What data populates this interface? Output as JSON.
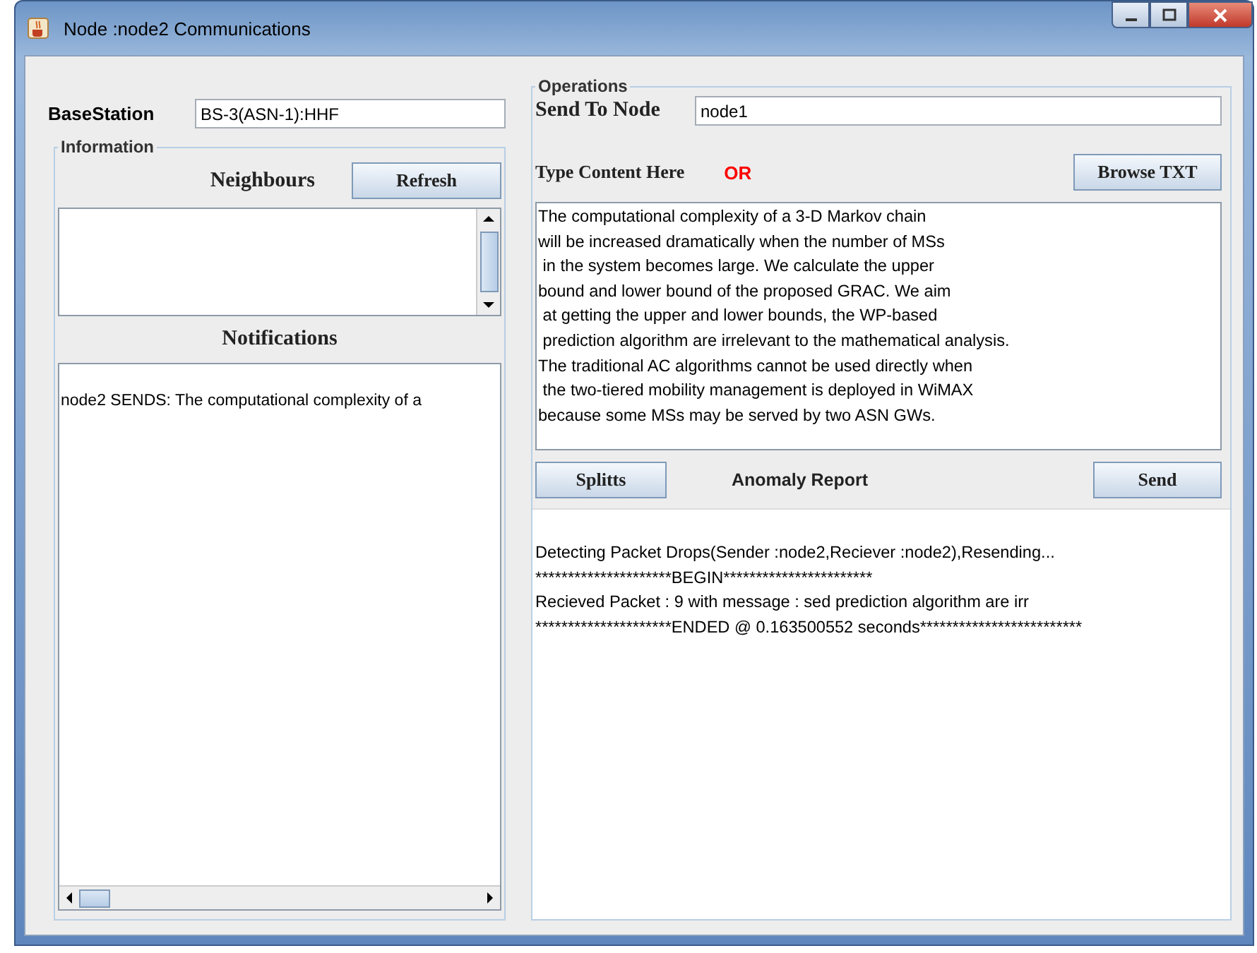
{
  "window": {
    "title": "Node :node2 Communications"
  },
  "base_station": {
    "label": "BaseStation",
    "value": "BS-3(ASN-1):HHF"
  },
  "information": {
    "legend": "Information",
    "neighbours_label": "Neighbours",
    "refresh_button": "Refresh",
    "notifications_label": "Notifications",
    "notifications": [
      "node2 SENDS: The computational complexity of a"
    ]
  },
  "operations": {
    "legend": "Operations",
    "send_to_label": "Send To Node",
    "send_to_value": "node1",
    "type_content_label": "Type Content Here",
    "or_label": "OR",
    "browse_button": "Browse TXT",
    "content": "The computational complexity of a 3-D Markov chain\nwill be increased dramatically when the number of MSs\n in the system becomes large. We calculate the upper\nbound and lower bound of the proposed GRAC. We aim\n at getting the upper and lower bounds, the WP-based\n prediction algorithm are irrelevant to the mathematical analysis.\nThe traditional AC algorithms cannot be used directly when\n the two-tiered mobility management is deployed in WiMAX\nbecause some MSs may be served by two ASN GWs.",
    "splitts_button": "Splitts",
    "anomaly_label": "Anomaly Report",
    "send_button": "Send",
    "log": [
      "Detecting Packet Drops(Sender :node2,Reciever :node2),Resending...",
      "*********************BEGIN***********************",
      "Recieved Packet : 9 with message : sed prediction algorithm are irr",
      "*********************ENDED @ 0.163500552 seconds*************************"
    ]
  }
}
